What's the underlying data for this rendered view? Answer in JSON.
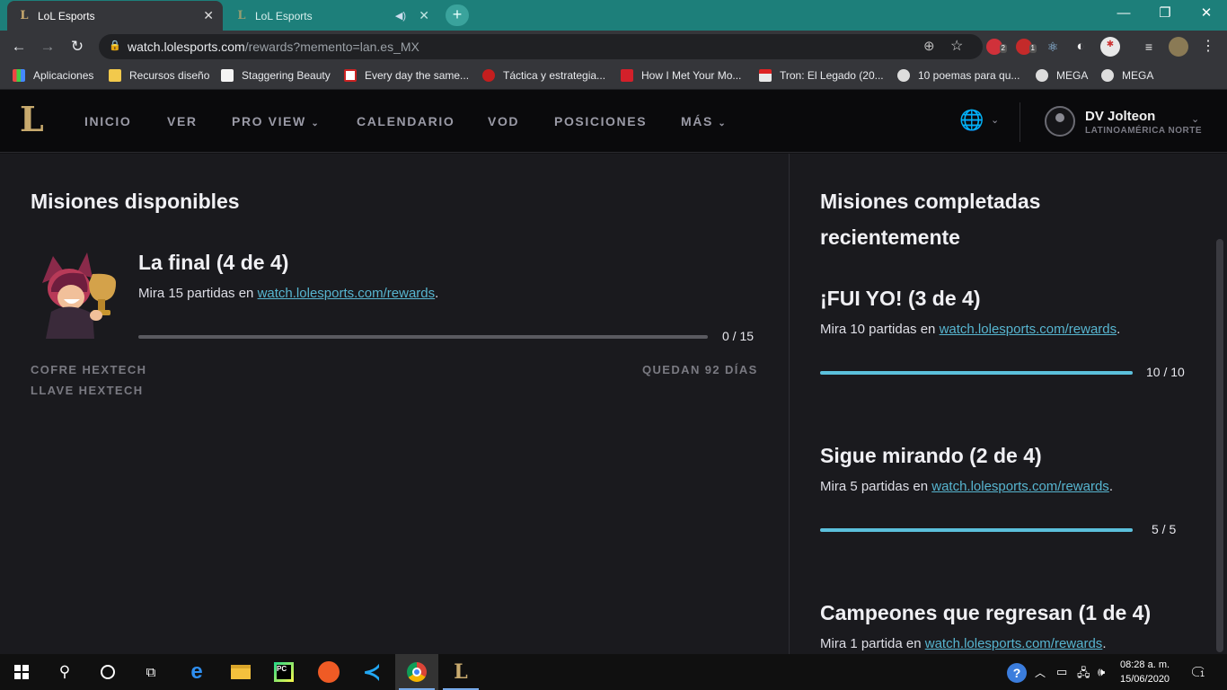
{
  "browser": {
    "tabs": [
      {
        "title": "LoL Esports",
        "active": true
      },
      {
        "title": "LoL Esports",
        "active": false,
        "audio": true
      }
    ],
    "url_host": "watch.lolesports.com",
    "url_path": "/rewards?memento=lan.es_MX",
    "extension_badges": {
      "ext1": "2",
      "ext2": "1"
    },
    "bookmarks": [
      {
        "label": "Aplicaciones",
        "icon": "apps-grid-icon"
      },
      {
        "label": "Recursos diseño",
        "icon": "folder-icon"
      },
      {
        "label": "Staggering Beauty",
        "icon": "page-icon"
      },
      {
        "label": "Every day the same...",
        "icon": "game-icon"
      },
      {
        "label": "Táctica y estrategia...",
        "icon": "rose-icon"
      },
      {
        "label": "How I Met Your Mo...",
        "icon": "clapper-icon"
      },
      {
        "label": "Tron: El Legado (20...",
        "icon": "popcorn-icon"
      },
      {
        "label": "10 poemas para qu...",
        "icon": "globe-icon"
      },
      {
        "label": "MEGA",
        "icon": "globe-icon"
      },
      {
        "label": "MEGA",
        "icon": "globe-icon"
      }
    ]
  },
  "site": {
    "nav": [
      {
        "label": "INICIO"
      },
      {
        "label": "VER"
      },
      {
        "label": "PRO VIEW",
        "dropdown": true
      },
      {
        "label": "CALENDARIO"
      },
      {
        "label": "VOD"
      },
      {
        "label": "POSICIONES"
      },
      {
        "label": "MÁS",
        "dropdown": true
      }
    ],
    "user": {
      "name": "DV Jolteon",
      "region": "LATINOAMÉRICA NORTE"
    }
  },
  "available": {
    "heading": "Misiones disponibles",
    "mission": {
      "title": "La final (4 de 4)",
      "desc_prefix": "Mira 15 partidas en ",
      "link": "watch.lolesports.com/rewards",
      "desc_suffix": ".",
      "progress_text": "0 / 15",
      "progress": 0,
      "rewards": [
        "COFRE HEXTECH",
        "LLAVE HEXTECH"
      ],
      "remaining": "QUEDAN 92 DÍAS"
    }
  },
  "completed": {
    "heading_line1": "Misiones completadas",
    "heading_line2": "recientemente",
    "missions": [
      {
        "title": "¡FUI YO! (3 de 4)",
        "desc_prefix": "Mira 10 partidas en ",
        "link": "watch.lolesports.com/rewards",
        "desc_suffix": ".",
        "progress_text": "10 / 10",
        "progress": 1.0
      },
      {
        "title": "Sigue mirando (2 de 4)",
        "desc_prefix": "Mira 5 partidas en ",
        "link": "watch.lolesports.com/rewards",
        "desc_suffix": ".",
        "progress_text": "5 / 5",
        "progress": 1.0
      },
      {
        "title": "Campeones que regresan (1 de 4)",
        "desc_prefix": "Mira 1 partida en ",
        "link": "watch.lolesports.com/rewards",
        "desc_suffix": "."
      }
    ]
  },
  "taskbar": {
    "apps": [
      "windows-start-icon",
      "search-icon",
      "cortana-icon",
      "task-view-icon",
      "edge-icon",
      "file-explorer-icon",
      "pycharm-icon",
      "postman-icon",
      "vscode-icon",
      "chrome-icon",
      "lol-esports-icon"
    ],
    "time": "08:28 a. m.",
    "date": "15/06/2020",
    "notification_count": "1"
  },
  "colors": {
    "accent": "#5bc0dc",
    "link": "#57b5d0",
    "gold": "#c8aa6e",
    "tab_strip": "#1d7f7a"
  }
}
